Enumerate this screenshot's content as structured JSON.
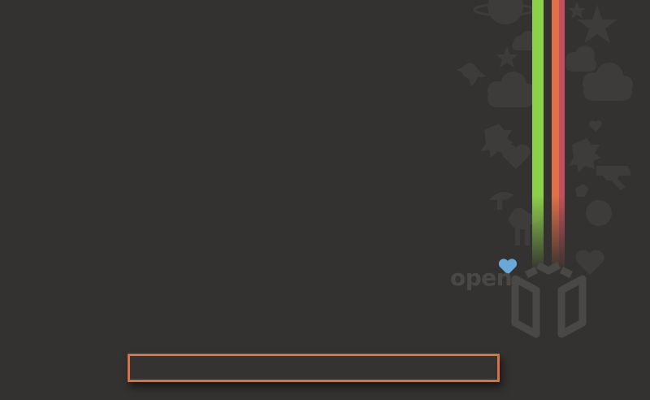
{
  "desktop": {
    "brand_label": "open",
    "input": {
      "value": "",
      "placeholder": ""
    }
  },
  "colors": {
    "background": "#343230",
    "stripe_green": "#8cd04a",
    "stripe_orange": "#e0704a",
    "stripe_red": "#c2505a",
    "heart_blue": "#6aa8d8",
    "input_border": "#d9704c",
    "silhouette": "#3d3b39"
  },
  "icons": [
    "planet-icon",
    "star-icon",
    "cloud-icon",
    "bird-icon",
    "sonic-head-icon",
    "heart-icon",
    "gun-icon",
    "mushroom-icon",
    "camel-icon",
    "cube-logo-icon"
  ]
}
